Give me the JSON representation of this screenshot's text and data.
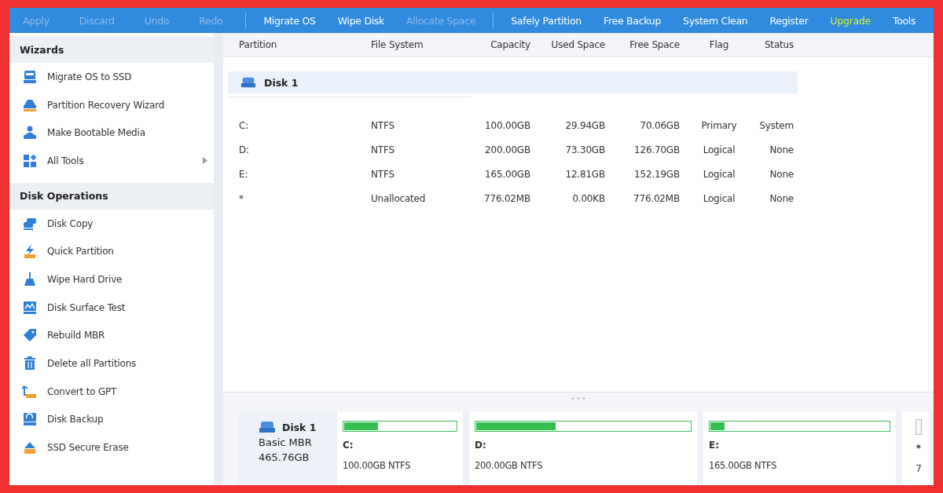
{
  "toolbar": [
    [
      {
        "label": "Apply",
        "disabled": true,
        "highlight": false
      },
      {
        "label": "Discard",
        "disabled": true,
        "highlight": false
      },
      {
        "label": "Undo",
        "disabled": true,
        "highlight": false
      },
      {
        "label": "Redo",
        "disabled": true,
        "highlight": false
      }
    ],
    [
      {
        "label": "Migrate OS",
        "disabled": false,
        "highlight": false
      },
      {
        "label": "Wipe Disk",
        "disabled": false,
        "highlight": false
      },
      {
        "label": "Allocate Space",
        "disabled": true,
        "highlight": false
      }
    ],
    [
      {
        "label": "Safely Partition",
        "disabled": false,
        "highlight": false
      },
      {
        "label": "Free Backup",
        "disabled": false,
        "highlight": false
      },
      {
        "label": "System Clean",
        "disabled": false,
        "highlight": false
      },
      {
        "label": "Register",
        "disabled": false,
        "highlight": false
      },
      {
        "label": "Upgrade",
        "disabled": false,
        "highlight": true
      },
      {
        "label": "Tools",
        "disabled": false,
        "highlight": false
      }
    ]
  ],
  "sidebar": {
    "sections": [
      {
        "title": "Wizards",
        "items": [
          {
            "label": "Migrate OS to SSD",
            "submenu": false
          },
          {
            "label": "Partition Recovery Wizard",
            "submenu": false
          },
          {
            "label": "Make Bootable Media",
            "submenu": false
          },
          {
            "label": "All Tools",
            "submenu": true
          }
        ]
      },
      {
        "title": "Disk Operations",
        "items": [
          {
            "label": "Disk Copy",
            "submenu": false
          },
          {
            "label": "Quick Partition",
            "submenu": false
          },
          {
            "label": "Wipe Hard Drive",
            "submenu": false
          },
          {
            "label": "Disk Surface Test",
            "submenu": false
          },
          {
            "label": "Rebuild MBR",
            "submenu": false
          },
          {
            "label": "Delete all Partitions",
            "submenu": false
          },
          {
            "label": "Convert to GPT",
            "submenu": false
          },
          {
            "label": "Disk Backup",
            "submenu": false
          },
          {
            "label": "SSD Secure Erase",
            "submenu": false
          }
        ]
      }
    ]
  },
  "table": {
    "columns": [
      "Partition",
      "File System",
      "Capacity",
      "Used Space",
      "Free Space",
      "Flag",
      "Status"
    ],
    "disk": "Disk 1",
    "rows": [
      [
        "C:",
        "NTFS",
        "100.00GB",
        "29.94GB",
        "70.06GB",
        "Primary",
        "System"
      ],
      [
        "D:",
        "NTFS",
        "200.00GB",
        "73.30GB",
        "126.70GB",
        "Logical",
        "None"
      ],
      [
        "E:",
        "NTFS",
        "165.00GB",
        "12.81GB",
        "152.19GB",
        "Logical",
        "None"
      ],
      [
        "*",
        "Unallocated",
        "776.02MB",
        "0.00KB",
        "776.02MB",
        "Logical",
        "None"
      ]
    ]
  },
  "disk_map": {
    "name": "Disk 1",
    "type": "Basic MBR",
    "size": "465.76GB",
    "partitions": [
      {
        "kind": "partition",
        "letter": "C:",
        "info": "100.00GB NTFS",
        "level": 0.3
      },
      {
        "kind": "partition",
        "letter": "D:",
        "info": "200.00GB NTFS",
        "level": 0.37
      },
      {
        "kind": "partition",
        "letter": "E:",
        "info": "165.00GB NTFS",
        "level": 0.08
      },
      {
        "kind": "unallocated",
        "letter": "*",
        "info": "7"
      }
    ]
  }
}
